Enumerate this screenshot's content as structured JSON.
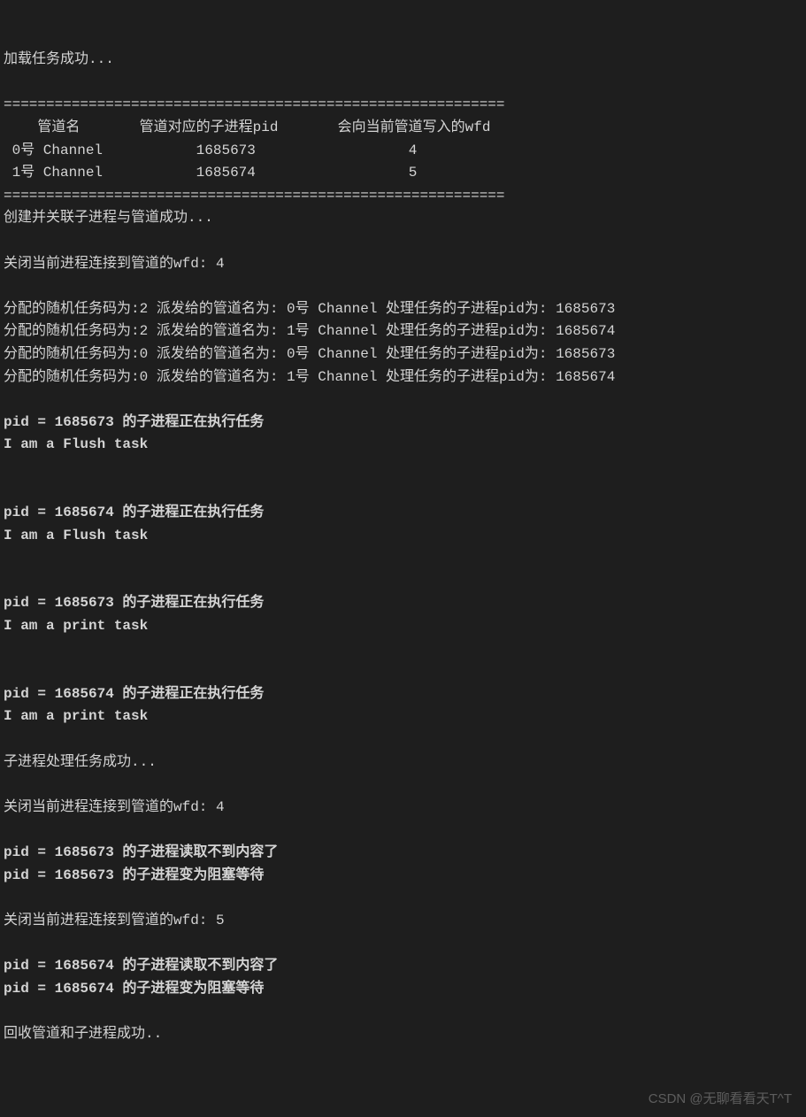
{
  "line_load_success": "加载任务成功...",
  "divider": "===========================================================",
  "table_header_col1": "    管道名",
  "table_header_col2": "管道对应的子进程pid",
  "table_header_col3": "会向当前管道写入的wfd",
  "row0_name": " 0号 Channel",
  "row0_pid": "1685673",
  "row0_wfd": "4",
  "row1_name": " 1号 Channel",
  "row1_pid": "1685674",
  "row1_wfd": "5",
  "create_success": "创建并关联子进程与管道成功...",
  "close_wfd_4a": "关闭当前进程连接到管道的wfd: 4",
  "dispatch_prefix_code": "分配的随机任务码为:",
  "dispatch_mid_name": " 派发给的管道名为: ",
  "dispatch_chan_suffix": " Channel 处理任务的子进程pid为: ",
  "d1_code": "2",
  "d1_chan": "0号",
  "d1_pid": "1685673",
  "d2_code": "2",
  "d2_chan": "1号",
  "d2_pid": "1685674",
  "d3_code": "0",
  "d3_chan": "0号",
  "d3_pid": "1685673",
  "d4_code": "0",
  "d4_chan": "1号",
  "d4_pid": "1685674",
  "exec_prefix": "pid = ",
  "exec_suffix": " 的子进程正在执行任务",
  "flush_task": "I am a Flush task",
  "print_task": "I am a print task",
  "e1_pid": "1685673",
  "e2_pid": "1685674",
  "e3_pid": "1685673",
  "e4_pid": "1685674",
  "child_success": "子进程处理任务成功...",
  "close_wfd_4b": "关闭当前进程连接到管道的wfd: 4",
  "read_none_suffix": " 的子进程读取不到内容了",
  "block_wait_suffix": " 的子进程变为阻塞等待",
  "r1_pid": "1685673",
  "close_wfd_5": "关闭当前进程连接到管道的wfd: 5",
  "r2_pid": "1685674",
  "recycle_success": "回收管道和子进程成功..",
  "watermark": "CSDN @无聊看看天T^T"
}
